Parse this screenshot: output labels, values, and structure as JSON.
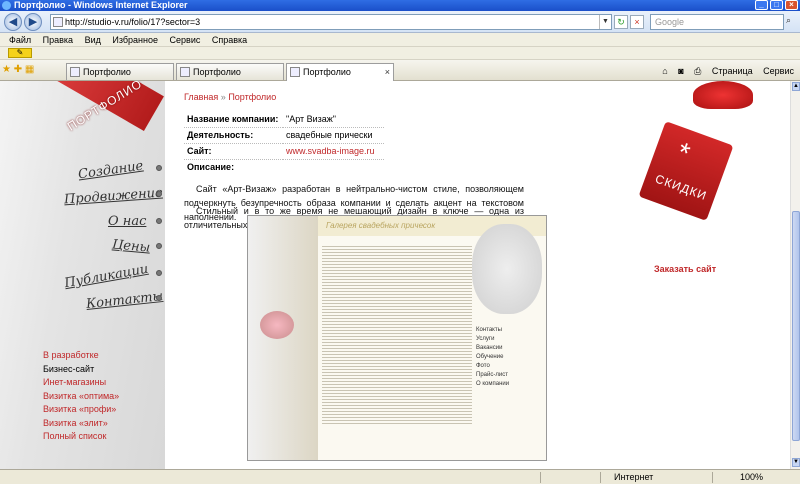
{
  "window": {
    "title": "Портфолио - Windows Internet Explorer"
  },
  "address": {
    "url": "http://studio-v.ru/folio/17?sector=3",
    "search_placeholder": "Google"
  },
  "menu": [
    "Файл",
    "Правка",
    "Вид",
    "Избранное",
    "Сервис",
    "Справка"
  ],
  "tabs": [
    "Портфолио",
    "Портфолио",
    "Портфолио"
  ],
  "toolbar": {
    "page": "Страница",
    "tools": "Сервис"
  },
  "status": {
    "zone": "Интернет",
    "zoom": "100%"
  },
  "site": {
    "ribbon_label": "ПОРТФОЛИО",
    "nav": [
      "Создание",
      "Продвижение",
      "О нас",
      "Цены",
      "Публикации",
      "Контакты"
    ],
    "sidelist": [
      {
        "label": "В разработке",
        "current": false
      },
      {
        "label": "Бизнес-сайт",
        "current": true
      },
      {
        "label": "Инет-магазины",
        "current": false
      },
      {
        "label": "Визитка «оптима»",
        "current": false
      },
      {
        "label": "Визитка «профи»",
        "current": false
      },
      {
        "label": "Визитка «элит»",
        "current": false
      },
      {
        "label": "Полный список",
        "current": false
      }
    ],
    "breadcrumb": {
      "home": "Главная",
      "sep": "»",
      "current": "Портфолио"
    },
    "info": {
      "company_k": "Название компании:",
      "company_v": "\"Арт Визаж\"",
      "activity_k": "Деятельность:",
      "activity_v": "свадебные прически",
      "site_k": "Сайт:",
      "site_v": "www.svadba-image.ru",
      "desc_k": "Описание:"
    },
    "p1": "Сайт «Арт-Визаж» разработан в нейтрально-чистом стиле, позволяющем подчеркнуть безупречность образа компании и сделать акцент на текстовом наполнении.",
    "p2": "Стильный и в то же время не мешающий дизайн в ключе — одна из отличительных черт данного бизнес-сайта.",
    "shot": {
      "header": "Галерея свадебных причесок",
      "menu": [
        "Контакты",
        "Услуги",
        "Вакансии",
        "Обучение",
        "Фото",
        "Прайс-лист",
        "О компании"
      ]
    },
    "tag_label": "СКИДКИ",
    "order": "Заказать сайт"
  }
}
